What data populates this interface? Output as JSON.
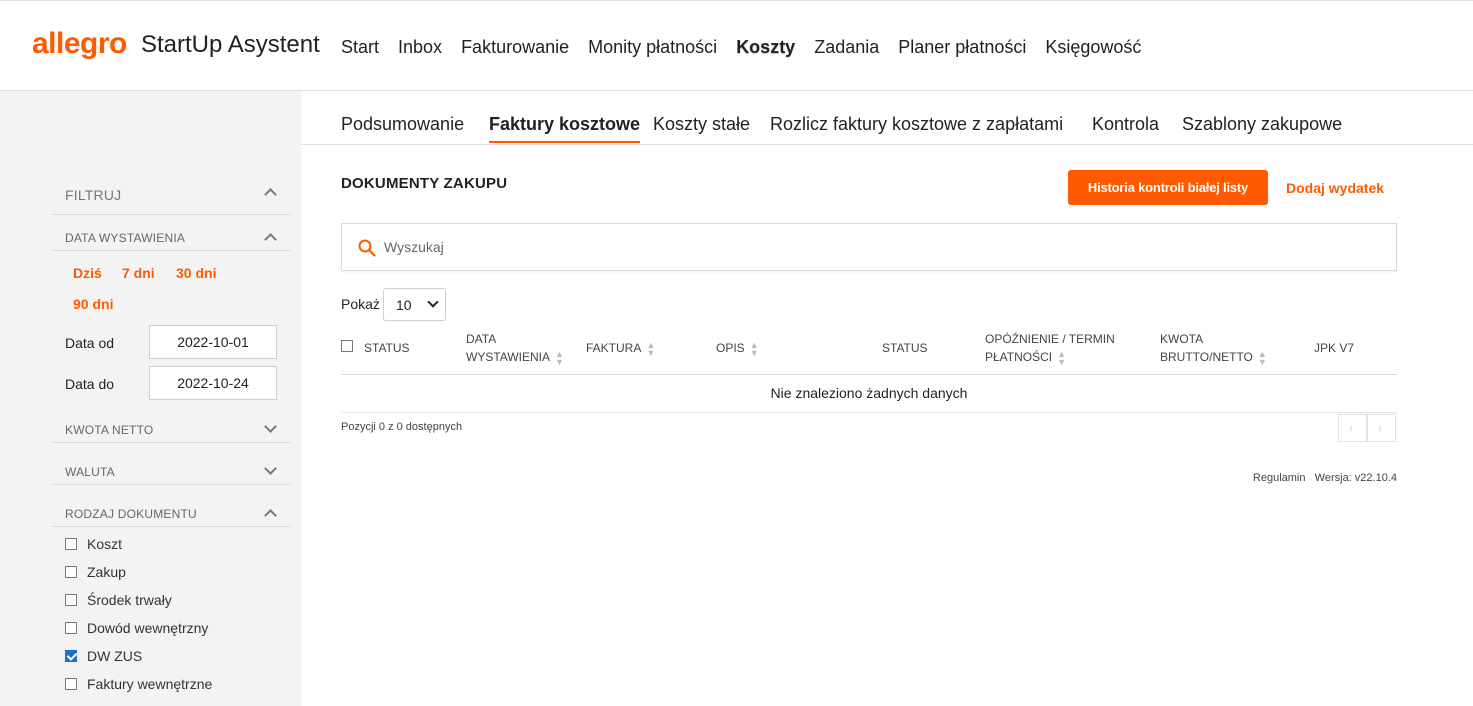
{
  "header": {
    "logo": "allegro",
    "app_name": "StartUp Asystent",
    "nav": [
      "Start",
      "Inbox",
      "Fakturowanie",
      "Monity płatności",
      "Koszty",
      "Zadania",
      "Planer płatności",
      "Księgowość"
    ],
    "active_nav": "Koszty"
  },
  "subnav": {
    "tabs": [
      "Podsumowanie",
      "Faktury kosztowe",
      "Koszty stałe",
      "Rozlicz faktury kosztowe z zapłatami",
      "Kontrola",
      "Szablony zakupowe"
    ],
    "active_tab": "Faktury kosztowe"
  },
  "sidebar": {
    "filter_title": "FILTRUJ",
    "date_section": "DATA WYSTAWIENIA",
    "quick_dates": [
      "Dziś",
      "7 dni",
      "30 dni",
      "90 dni"
    ],
    "date_from_label": "Data od",
    "date_from_value": "2022-10-01",
    "date_to_label": "Data do",
    "date_to_value": "2022-10-24",
    "net_amount_section": "KWOTA NETTO",
    "currency_section": "WALUTA",
    "doc_type_section": "RODZAJ DOKUMENTU",
    "doc_types": [
      {
        "label": "Koszt",
        "checked": false
      },
      {
        "label": "Zakup",
        "checked": false
      },
      {
        "label": "Środek trwały",
        "checked": false
      },
      {
        "label": "Dowód wewnętrzny",
        "checked": false
      },
      {
        "label": "DW ZUS",
        "checked": true
      },
      {
        "label": "Faktury wewnętrzne",
        "checked": false
      }
    ]
  },
  "main": {
    "title": "DOKUMENTY ZAKUPU",
    "btn_history": "Historia kontroli białej listy",
    "link_add": "Dodaj wydatek",
    "search_placeholder": "Wyszukaj",
    "show_label": "Pokaż",
    "show_value": "10",
    "columns": {
      "status": "STATUS",
      "date_line1": "DATA",
      "date_line2": "WYSTAWIENIA",
      "invoice": "FAKTURA",
      "description": "OPIS",
      "status2": "STATUS",
      "delay_line1": "OPÓŹNIENIE / TERMIN",
      "delay_line2": "PŁATNOŚCI",
      "amount_line1": "KWOTA",
      "amount_line2": "BRUTTO/NETTO",
      "jpk": "JPK V7"
    },
    "empty_message": "Nie znaleziono żadnych danych",
    "pager_info": "Pozycji 0 z 0 dostępnych",
    "pager_prev": "‹",
    "pager_next": "›"
  },
  "footer": {
    "terms": "Regulamin",
    "version": "Wersja: v22.10.4"
  },
  "colors": {
    "accent": "#ff5a00",
    "sidebar_bg": "#f3f3f3",
    "checkbox_checked": "#1a73c8"
  }
}
